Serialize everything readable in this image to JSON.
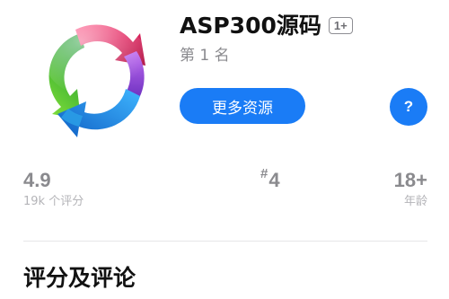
{
  "app": {
    "title": "ASP300源码",
    "age_badge": "1+",
    "rank_line": "第 1 名",
    "icon": "circular-arrows-icon"
  },
  "actions": {
    "more_label": "更多资源",
    "help_label": "?"
  },
  "stats": {
    "rating": {
      "value": "4.9",
      "caption": "19k 个评分"
    },
    "rank": {
      "hash": "#",
      "value": "4"
    },
    "age": {
      "value": "18+",
      "caption": "年龄"
    }
  },
  "sections": {
    "ratings_title": "评分及评论"
  },
  "colors": {
    "accent": "#1a7cf6",
    "secondary_text": "#8a8a8e",
    "caption_text": "#b4b4b8"
  }
}
